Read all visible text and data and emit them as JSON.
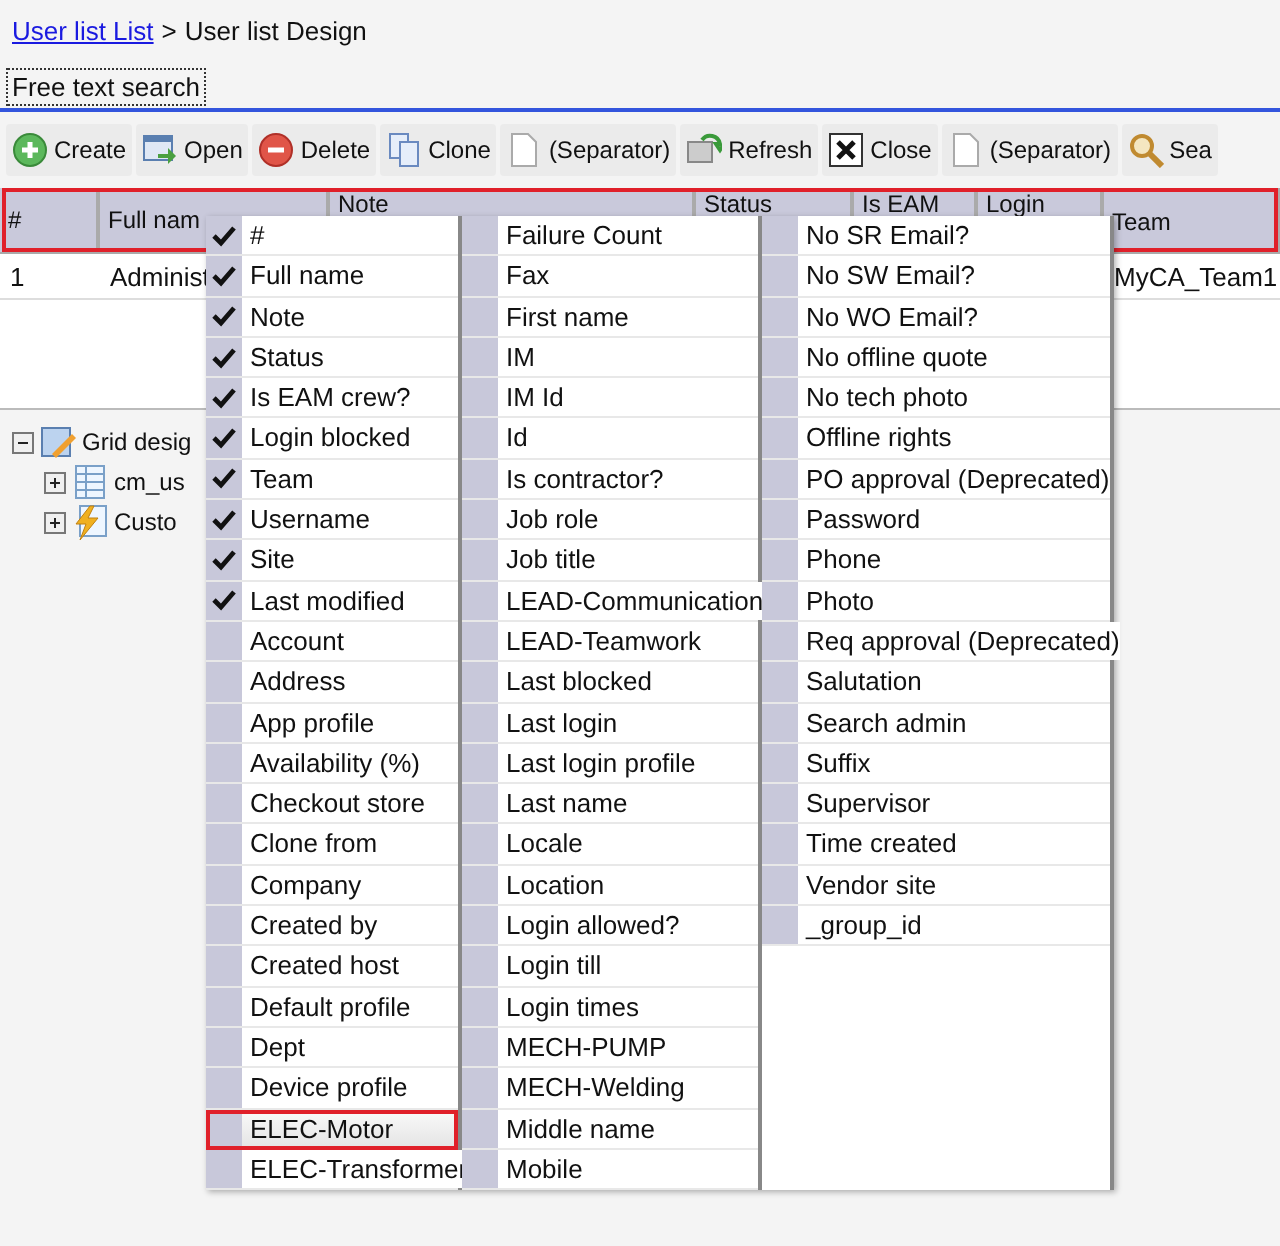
{
  "breadcrumb": {
    "link": "User list List",
    "separator": ">",
    "current": "User list Design"
  },
  "search_tab": {
    "label": "Free text search"
  },
  "toolbar": [
    {
      "label": "Create"
    },
    {
      "label": "Open"
    },
    {
      "label": "Delete"
    },
    {
      "label": "Clone"
    },
    {
      "label": "(Separator)"
    },
    {
      "label": "Refresh"
    },
    {
      "label": "Close"
    },
    {
      "label": "(Separator)"
    },
    {
      "label": "Sea"
    }
  ],
  "grid": {
    "columns": [
      {
        "label": "#"
      },
      {
        "label": "Full nam"
      },
      {
        "label": "Note"
      },
      {
        "label": "Status"
      },
      {
        "label": "Is EAM"
      },
      {
        "label": "Login"
      },
      {
        "label": "Team"
      }
    ],
    "rows": [
      [
        "1",
        "Administ",
        "",
        "",
        "",
        "",
        "MyCA_Team1"
      ]
    ]
  },
  "tree": {
    "label": "Grid desig",
    "expanded": true,
    "children": [
      {
        "label": "cm_us",
        "expanded": false
      },
      {
        "label": "Custo",
        "expanded": false
      }
    ]
  },
  "column_menu": [
    [
      {
        "label": "#",
        "checked": true,
        "selected": false
      },
      {
        "label": "Full name",
        "checked": true,
        "selected": false
      },
      {
        "label": "Note",
        "checked": true,
        "selected": false
      },
      {
        "label": "Status",
        "checked": true,
        "selected": false
      },
      {
        "label": "Is EAM crew?",
        "checked": true,
        "selected": false
      },
      {
        "label": "Login blocked",
        "checked": true,
        "selected": false
      },
      {
        "label": "Team",
        "checked": true,
        "selected": false
      },
      {
        "label": "Username",
        "checked": true,
        "selected": false
      },
      {
        "label": "Site",
        "checked": true,
        "selected": false
      },
      {
        "label": "Last modified",
        "checked": true,
        "selected": false
      },
      {
        "label": "Account",
        "checked": false,
        "selected": false
      },
      {
        "label": "Address",
        "checked": false,
        "selected": false
      },
      {
        "label": "App profile",
        "checked": false,
        "selected": false
      },
      {
        "label": "Availability (%)",
        "checked": false,
        "selected": false
      },
      {
        "label": "Checkout store",
        "checked": false,
        "selected": false
      },
      {
        "label": "Clone from",
        "checked": false,
        "selected": false
      },
      {
        "label": "Company",
        "checked": false,
        "selected": false
      },
      {
        "label": "Created by",
        "checked": false,
        "selected": false
      },
      {
        "label": "Created host",
        "checked": false,
        "selected": false
      },
      {
        "label": "Default profile",
        "checked": false,
        "selected": false
      },
      {
        "label": "Dept",
        "checked": false,
        "selected": false
      },
      {
        "label": "Device profile",
        "checked": false,
        "selected": false
      },
      {
        "label": "ELEC-Motor",
        "checked": false,
        "selected": true
      },
      {
        "label": "ELEC-Transformer",
        "checked": false,
        "selected": false
      }
    ],
    [
      {
        "label": "Failure Count",
        "checked": false,
        "selected": false
      },
      {
        "label": "Fax",
        "checked": false,
        "selected": false
      },
      {
        "label": "First name",
        "checked": false,
        "selected": false
      },
      {
        "label": "IM",
        "checked": false,
        "selected": false
      },
      {
        "label": "IM Id",
        "checked": false,
        "selected": false
      },
      {
        "label": "Id",
        "checked": false,
        "selected": false
      },
      {
        "label": "Is contractor?",
        "checked": false,
        "selected": false
      },
      {
        "label": "Job role",
        "checked": false,
        "selected": false
      },
      {
        "label": "Job title",
        "checked": false,
        "selected": false
      },
      {
        "label": "LEAD-Communication",
        "checked": false,
        "selected": false
      },
      {
        "label": "LEAD-Teamwork",
        "checked": false,
        "selected": false
      },
      {
        "label": "Last blocked",
        "checked": false,
        "selected": false
      },
      {
        "label": "Last login",
        "checked": false,
        "selected": false
      },
      {
        "label": "Last login profile",
        "checked": false,
        "selected": false
      },
      {
        "label": "Last name",
        "checked": false,
        "selected": false
      },
      {
        "label": "Locale",
        "checked": false,
        "selected": false
      },
      {
        "label": "Location",
        "checked": false,
        "selected": false
      },
      {
        "label": "Login allowed?",
        "checked": false,
        "selected": false
      },
      {
        "label": "Login till",
        "checked": false,
        "selected": false
      },
      {
        "label": "Login times",
        "checked": false,
        "selected": false
      },
      {
        "label": "MECH-PUMP",
        "checked": false,
        "selected": false
      },
      {
        "label": "MECH-Welding",
        "checked": false,
        "selected": false
      },
      {
        "label": "Middle name",
        "checked": false,
        "selected": false
      },
      {
        "label": "Mobile",
        "checked": false,
        "selected": false
      }
    ],
    [
      {
        "label": "No SR Email?",
        "checked": false,
        "selected": false
      },
      {
        "label": "No SW Email?",
        "checked": false,
        "selected": false
      },
      {
        "label": "No WO Email?",
        "checked": false,
        "selected": false
      },
      {
        "label": "No offline quote",
        "checked": false,
        "selected": false
      },
      {
        "label": "No tech photo",
        "checked": false,
        "selected": false
      },
      {
        "label": "Offline rights",
        "checked": false,
        "selected": false
      },
      {
        "label": "PO approval (Deprecated)",
        "checked": false,
        "selected": false
      },
      {
        "label": "Password",
        "checked": false,
        "selected": false
      },
      {
        "label": "Phone",
        "checked": false,
        "selected": false
      },
      {
        "label": "Photo",
        "checked": false,
        "selected": false
      },
      {
        "label": "Req approval (Deprecated)",
        "checked": false,
        "selected": false
      },
      {
        "label": "Salutation",
        "checked": false,
        "selected": false
      },
      {
        "label": "Search admin",
        "checked": false,
        "selected": false
      },
      {
        "label": "Suffix",
        "checked": false,
        "selected": false
      },
      {
        "label": "Supervisor",
        "checked": false,
        "selected": false
      },
      {
        "label": "Time created",
        "checked": false,
        "selected": false
      },
      {
        "label": "Vendor site",
        "checked": false,
        "selected": false
      },
      {
        "label": "_group_id",
        "checked": false,
        "selected": false
      }
    ]
  ]
}
